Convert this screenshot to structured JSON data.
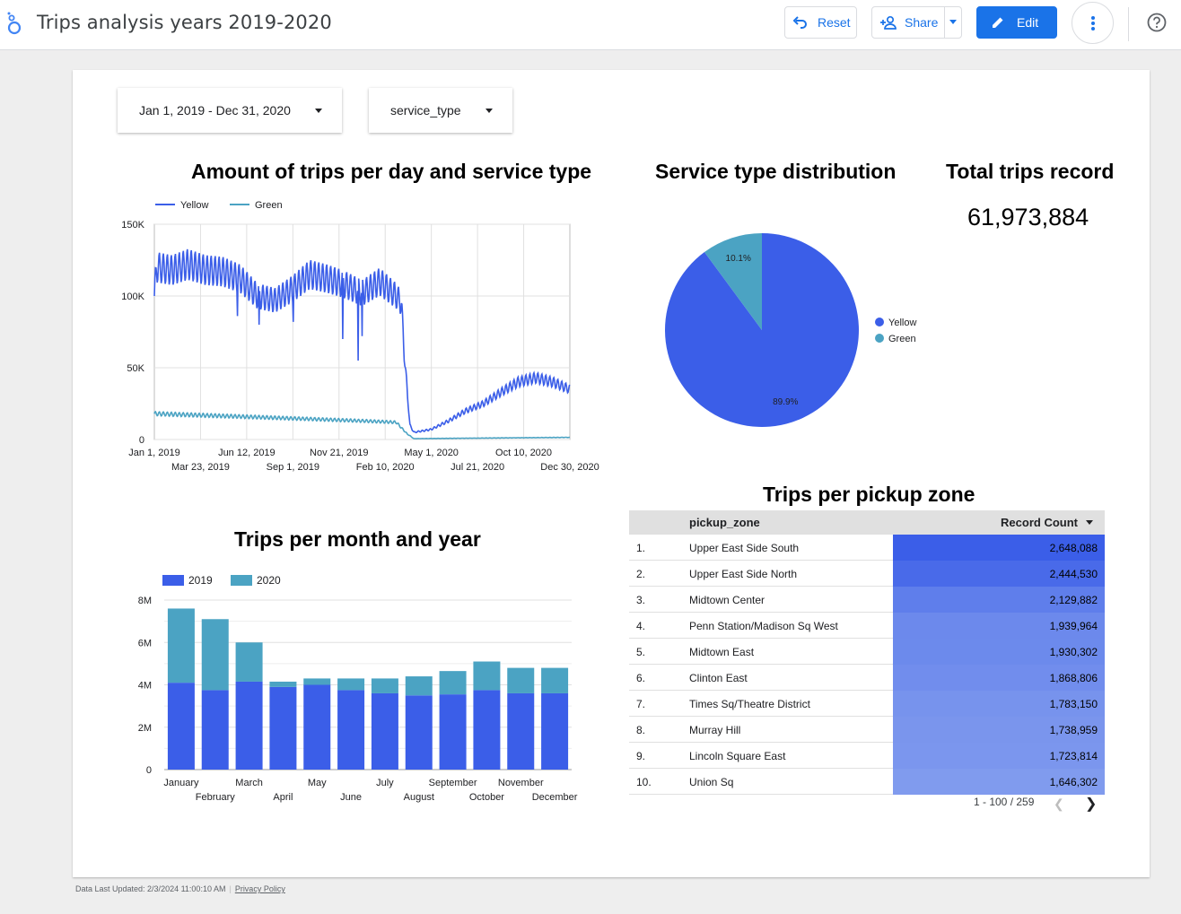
{
  "app": {
    "title": "Trips analysis years 2019-2020",
    "buttons": {
      "reset": "Reset",
      "share": "Share",
      "edit": "Edit"
    }
  },
  "filters": {
    "date_range": "Jan 1, 2019 - Dec 31, 2020",
    "service_type": "service_type"
  },
  "colors": {
    "yellow": "#3b5ee8",
    "green": "#4ba3c3",
    "accent": "#1a73e8"
  },
  "line_chart": {
    "title": "Amount of trips per day and service type",
    "chart_data": {
      "type": "line",
      "series": [
        {
          "name": "Yellow",
          "keypoints": [
            [
              "2019-01-01",
              100000
            ],
            [
              "2019-01-05",
              120000
            ],
            [
              "2019-02-01",
              118000
            ],
            [
              "2019-03-01",
              122000
            ],
            [
              "2019-04-01",
              118000
            ],
            [
              "2019-05-01",
              117000
            ],
            [
              "2019-06-01",
              112000
            ],
            [
              "2019-07-01",
              100000
            ],
            [
              "2019-08-01",
              97000
            ],
            [
              "2019-09-01",
              105000
            ],
            [
              "2019-10-01",
              115000
            ],
            [
              "2019-11-01",
              112000
            ],
            [
              "2019-12-01",
              108000
            ],
            [
              "2020-01-01",
              102000
            ],
            [
              "2020-02-01",
              110000
            ],
            [
              "2020-03-01",
              100000
            ],
            [
              "2020-03-10",
              95000
            ],
            [
              "2020-03-15",
              60000
            ],
            [
              "2020-03-25",
              10000
            ],
            [
              "2020-04-01",
              5000
            ],
            [
              "2020-05-01",
              7000
            ],
            [
              "2020-06-01",
              13000
            ],
            [
              "2020-07-01",
              20000
            ],
            [
              "2020-08-01",
              25000
            ],
            [
              "2020-09-01",
              33000
            ],
            [
              "2020-10-01",
              40000
            ],
            [
              "2020-11-01",
              43000
            ],
            [
              "2020-12-01",
              40000
            ],
            [
              "2020-12-31",
              35000
            ]
          ],
          "dips": [
            [
              "2019-05-27",
              86000
            ],
            [
              "2019-07-04",
              80000
            ],
            [
              "2019-09-02",
              82000
            ],
            [
              "2019-11-28",
              70000
            ],
            [
              "2019-12-25",
              55000
            ],
            [
              "2020-01-01",
              72000
            ]
          ]
        },
        {
          "name": "Green",
          "keypoints": [
            [
              "2019-01-01",
              18000
            ],
            [
              "2019-06-01",
              16000
            ],
            [
              "2019-12-31",
              13000
            ],
            [
              "2020-03-01",
              12000
            ],
            [
              "2020-03-20",
              4000
            ],
            [
              "2020-04-01",
              600
            ],
            [
              "2020-12-31",
              1500
            ]
          ]
        }
      ],
      "xlim": [
        "2019-01-01",
        "2020-12-31"
      ],
      "ylim": [
        0,
        150000
      ],
      "y_ticks": [
        {
          "v": 0,
          "label": "0"
        },
        {
          "v": 50000,
          "label": "50K"
        },
        {
          "v": 100000,
          "label": "100K"
        },
        {
          "v": 150000,
          "label": "150K"
        }
      ],
      "x_ticks_top": [
        "Jan 1, 2019",
        "Jun 12, 2019",
        "Nov 21, 2019",
        "May 1, 2020",
        "Oct 10, 2020"
      ],
      "x_ticks_bottom": [
        "Mar 23, 2019",
        "Sep 1, 2019",
        "Feb 10, 2020",
        "Jul 21, 2020",
        "Dec 30, 2020"
      ],
      "grid": true,
      "legend": "top-left"
    }
  },
  "pie_chart": {
    "title": "Service type distribution",
    "chart_data": {
      "type": "pie",
      "slices": [
        {
          "name": "Yellow",
          "value": 89.9,
          "label": "89.9%"
        },
        {
          "name": "Green",
          "value": 10.1,
          "label": "10.1%"
        }
      ],
      "legend": "right"
    }
  },
  "kpi": {
    "title": "Total trips record",
    "value": "61,973,884"
  },
  "bar_chart": {
    "title": "Trips per month and year",
    "chart_data": {
      "type": "bar",
      "stacked": true,
      "categories": [
        "January",
        "February",
        "March",
        "April",
        "May",
        "June",
        "July",
        "August",
        "September",
        "October",
        "November",
        "December"
      ],
      "series": [
        {
          "name": "2019",
          "values": [
            4100000,
            3750000,
            4150000,
            3900000,
            4000000,
            3750000,
            3600000,
            3500000,
            3550000,
            3750000,
            3600000,
            3600000
          ]
        },
        {
          "name": "2020",
          "values": [
            3500000,
            3350000,
            1850000,
            250000,
            300000,
            550000,
            700000,
            900000,
            1100000,
            1350000,
            1200000,
            1200000
          ]
        }
      ],
      "ylim": [
        0,
        8000000
      ],
      "y_ticks": [
        {
          "v": 0,
          "label": "0"
        },
        {
          "v": 2000000,
          "label": "2M"
        },
        {
          "v": 4000000,
          "label": "4M"
        },
        {
          "v": 6000000,
          "label": "6M"
        },
        {
          "v": 8000000,
          "label": "8M"
        }
      ],
      "grid": true,
      "legend": "top-left"
    }
  },
  "table": {
    "title": "Trips per pickup zone",
    "columns": [
      "pickup_zone",
      "Record Count"
    ],
    "rows": [
      {
        "idx": "1.",
        "zone": "Upper East Side South",
        "count": "2,648,088",
        "value": 2648088
      },
      {
        "idx": "2.",
        "zone": "Upper East Side North",
        "count": "2,444,530",
        "value": 2444530
      },
      {
        "idx": "3.",
        "zone": "Midtown Center",
        "count": "2,129,882",
        "value": 2129882
      },
      {
        "idx": "4.",
        "zone": "Penn Station/Madison Sq West",
        "count": "1,939,964",
        "value": 1939964
      },
      {
        "idx": "5.",
        "zone": "Midtown East",
        "count": "1,930,302",
        "value": 1930302
      },
      {
        "idx": "6.",
        "zone": "Clinton East",
        "count": "1,868,806",
        "value": 1868806
      },
      {
        "idx": "7.",
        "zone": "Times Sq/Theatre District",
        "count": "1,783,150",
        "value": 1783150
      },
      {
        "idx": "8.",
        "zone": "Murray Hill",
        "count": "1,738,959",
        "value": 1738959
      },
      {
        "idx": "9.",
        "zone": "Lincoln Square East",
        "count": "1,723,814",
        "value": 1723814
      },
      {
        "idx": "10.",
        "zone": "Union Sq",
        "count": "1,646,302",
        "value": 1646302
      }
    ],
    "pagination": "1 - 100 / 259"
  },
  "footer": {
    "updated": "Data Last Updated: 2/3/2024 11:00:10 AM",
    "privacy": "Privacy Policy"
  }
}
